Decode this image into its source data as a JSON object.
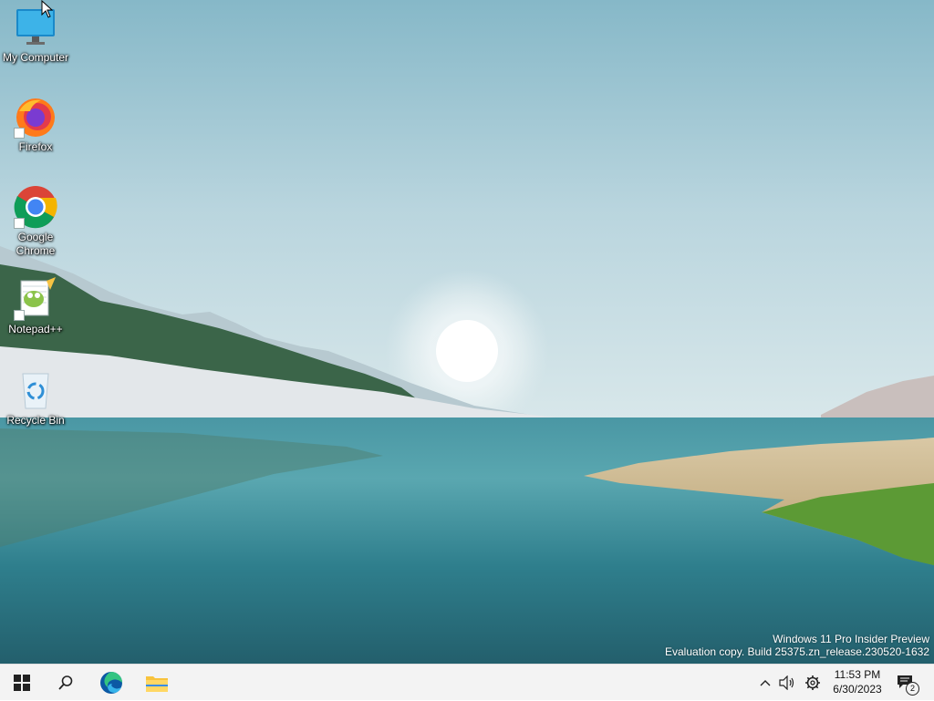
{
  "desktop": {
    "icons": [
      {
        "label": "My Computer",
        "icon": "monitor-icon"
      },
      {
        "label": "Firefox",
        "icon": "firefox-icon"
      },
      {
        "label": "Google Chrome",
        "icon": "chrome-icon"
      },
      {
        "label": "Notepad++",
        "icon": "notepadpp-icon"
      },
      {
        "label": "Recycle Bin",
        "icon": "recycle-bin-icon"
      }
    ],
    "watermark": {
      "line1": "Windows 11 Pro Insider Preview",
      "line2": "Evaluation copy. Build 25375.zn_release.230520-1632"
    }
  },
  "taskbar": {
    "buttons": [
      {
        "name": "start",
        "icon": "windows-logo-icon"
      },
      {
        "name": "search",
        "icon": "search-icon"
      },
      {
        "name": "edge",
        "icon": "edge-icon"
      },
      {
        "name": "file-explorer",
        "icon": "folder-icon"
      }
    ],
    "tray": {
      "icons": [
        "chevron-up-icon",
        "speaker-icon",
        "gear-icon"
      ],
      "time": "11:53 PM",
      "date": "6/30/2023",
      "notification_count": "2"
    }
  },
  "colors": {
    "taskbar_bg": "#f3f3f3",
    "windows_blue": "#0078d4",
    "folder_yellow": "#f8c33d"
  }
}
